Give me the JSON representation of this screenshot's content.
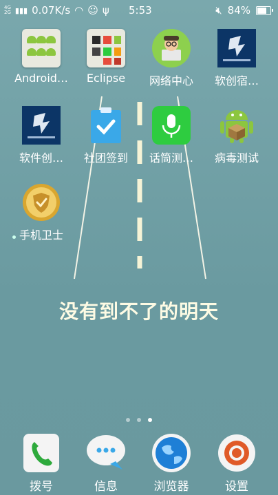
{
  "status_bar": {
    "net_top": "4G",
    "net_bottom": "2G",
    "speed": "0.07K/s",
    "time": "5:53",
    "battery": "84%",
    "battery_level": 0.84
  },
  "apps": [
    {
      "name": "Android…"
    },
    {
      "name": "Eclipse"
    },
    {
      "name": "网络中心"
    },
    {
      "name": "软创宿…"
    },
    {
      "name": "软件创…"
    },
    {
      "name": "社团签到"
    },
    {
      "name": "话筒测…"
    },
    {
      "name": "病毒测试"
    },
    {
      "name": "手机卫士"
    }
  ],
  "wallpaper_text": "没有到不了的明天",
  "page_indicator": {
    "count": 3,
    "active": 3
  },
  "dock": [
    {
      "name": "拨号"
    },
    {
      "name": "信息"
    },
    {
      "name": "浏览器"
    },
    {
      "name": "设置"
    }
  ],
  "colors": {
    "wallpaper": "#6e9ea3",
    "quote": "#fdfbe4",
    "mic_green": "#2ecc40",
    "clipboard_blue": "#3aa8e8"
  }
}
